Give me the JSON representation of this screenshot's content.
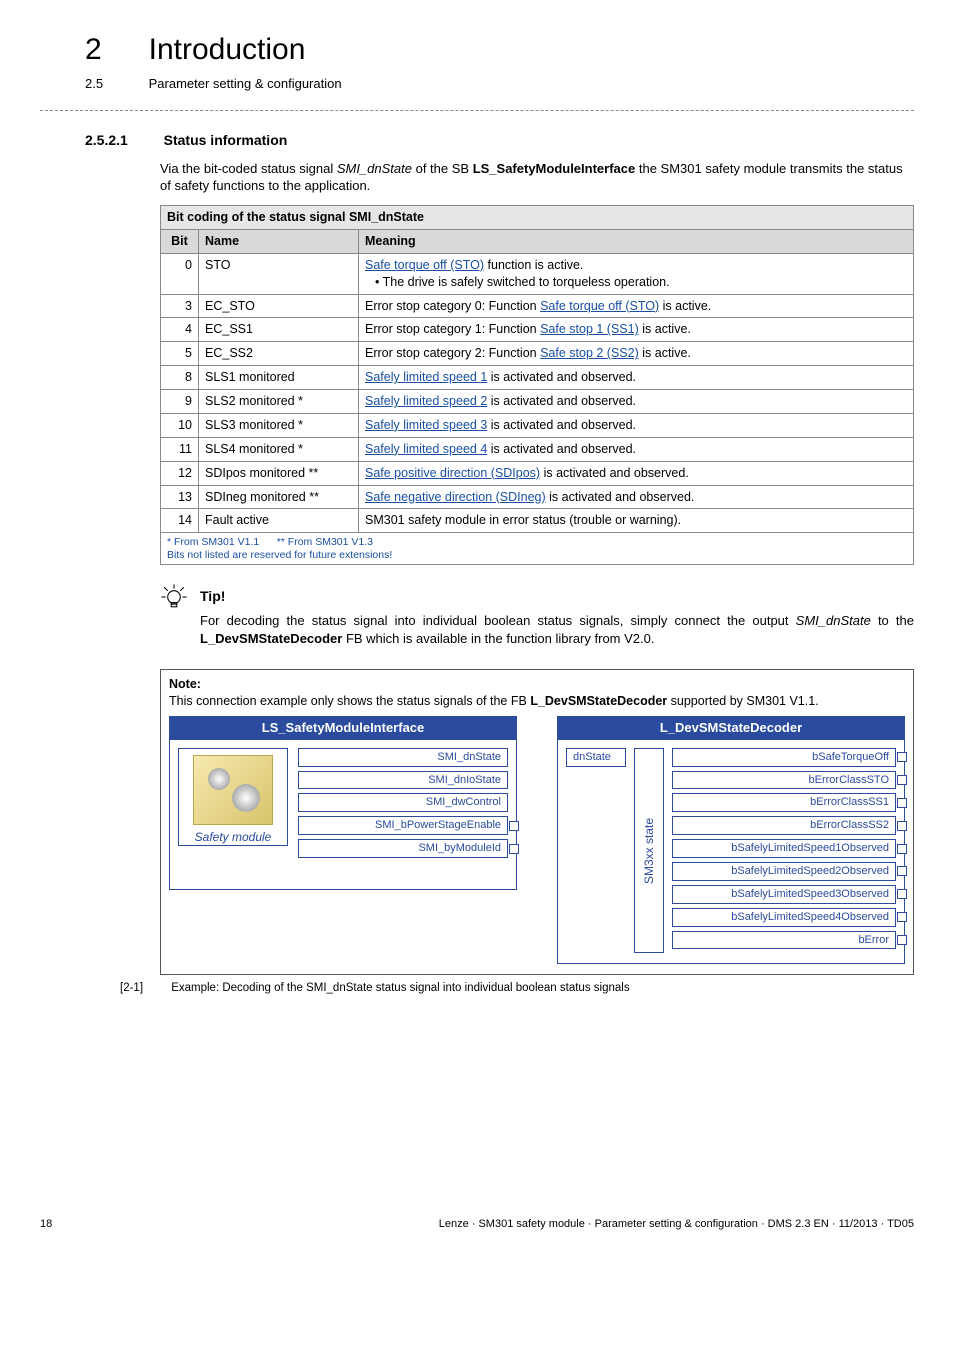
{
  "header": {
    "chapter_num": "2",
    "chapter_title": "Introduction",
    "section_num": "2.5",
    "section_title": "Parameter setting & configuration"
  },
  "section": {
    "num": "2.5.2.1",
    "title": "Status information",
    "intro_pre": "Via the bit-coded status signal ",
    "intro_sig": "SMI_dnState",
    "intro_mid": " of the SB ",
    "intro_sb": "LS_SafetyModuleInterface",
    "intro_post": " the SM301 safety module transmits the status of safety functions to the application."
  },
  "table": {
    "caption": "Bit coding of the status signal SMI_dnState",
    "head_bit": "Bit",
    "head_name": "Name",
    "head_meaning": "Meaning",
    "rows": [
      {
        "bit": "0",
        "name": "STO",
        "link": "Safe torque off (STO)",
        "post": " function is active.",
        "sub": "• The drive is safely switched to torqueless operation."
      },
      {
        "bit": "3",
        "name": "EC_STO",
        "pre": "Error stop category 0: Function ",
        "link": "Safe torque off (STO)",
        "post": " is active."
      },
      {
        "bit": "4",
        "name": "EC_SS1",
        "pre": "Error stop category 1: Function ",
        "link": "Safe stop 1 (SS1)",
        "post": " is active."
      },
      {
        "bit": "5",
        "name": "EC_SS2",
        "pre": "Error stop category 2: Function ",
        "link": "Safe stop 2 (SS2)",
        "post": " is active."
      },
      {
        "bit": "8",
        "name": "SLS1 monitored",
        "link": "Safely limited speed 1",
        "post": " is activated and observed."
      },
      {
        "bit": "9",
        "name": "SLS2 monitored *",
        "link": "Safely limited speed 2",
        "post": " is activated and observed."
      },
      {
        "bit": "10",
        "name": "SLS3 monitored *",
        "link": "Safely limited speed 3",
        "post": " is activated and observed."
      },
      {
        "bit": "11",
        "name": "SLS4 monitored *",
        "link": "Safely limited speed 4",
        "post": " is activated and observed."
      },
      {
        "bit": "12",
        "name": "SDIpos monitored **",
        "link": "Safe positive direction (SDIpos)",
        "post": " is activated and observed."
      },
      {
        "bit": "13",
        "name": "SDIneg monitored **",
        "link": "Safe negative direction (SDIneg)",
        "post": " is activated and observed."
      },
      {
        "bit": "14",
        "name": "Fault active",
        "plain": "SM301 safety module in error status (trouble or warning)."
      }
    ],
    "foot1": "* From SM301 V1.1",
    "foot2": "** From SM301 V1.3",
    "foot3": "Bits not listed are reserved for future extensions!"
  },
  "tip": {
    "label": "Tip!",
    "body_pre": "For decoding the status signal into individual boolean status signals, simply connect the output ",
    "body_sig": "SMI_dnState",
    "body_mid": " to the ",
    "body_fb": "L_DevSMStateDecoder",
    "body_post": " FB which is available in the function library from V2.0."
  },
  "note": {
    "label": "Note:",
    "text_pre": "This connection example only shows the status signals of the FB ",
    "text_fb": "L_DevSMStateDecoder",
    "text_post": " supported by SM301 V1.1."
  },
  "fb_left": {
    "title": "LS_SafetyModuleInterface",
    "safety_label": "Safety module",
    "ports": [
      "SMI_dnState",
      "SMI_dnIoState",
      "SMI_dwControl",
      "SMI_bPowerStageEnable",
      "SMI_byModuleId"
    ]
  },
  "fb_right": {
    "title": "L_DevSMStateDecoder",
    "input": "dnState",
    "vert": "SM3xx state",
    "ports": [
      "bSafeTorqueOff",
      "bErrorClassSTO",
      "bErrorClassSS1",
      "bErrorClassSS2",
      "bSafelyLimitedSpeed1Observed",
      "bSafelyLimitedSpeed2Observed",
      "bSafelyLimitedSpeed3Observed",
      "bSafelyLimitedSpeed4Observed",
      "bError"
    ]
  },
  "caption": {
    "tag": "[2-1]",
    "text": "Example: Decoding of the SMI_dnState status signal into individual boolean status signals"
  },
  "footer": {
    "page": "18",
    "text": "Lenze · SM301 safety module · Parameter setting & configuration · DMS 2.3 EN · 11/2013 · TD05"
  }
}
